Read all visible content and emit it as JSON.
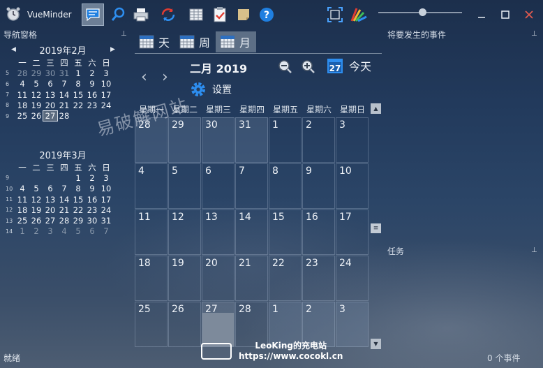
{
  "app": {
    "name": "VueMinder"
  },
  "nav_pane": {
    "title": "导航窗格"
  },
  "mini_calendars": [
    {
      "title": "2019年2月",
      "weekdays": [
        "一",
        "二",
        "三",
        "四",
        "五",
        "六",
        "日"
      ],
      "weeks": [
        {
          "num": "5",
          "days": [
            {
              "d": "28",
              "dim": true
            },
            {
              "d": "29",
              "dim": true
            },
            {
              "d": "30",
              "dim": true
            },
            {
              "d": "31",
              "dim": true
            },
            {
              "d": "1"
            },
            {
              "d": "2"
            },
            {
              "d": "3"
            }
          ]
        },
        {
          "num": "6",
          "days": [
            {
              "d": "4"
            },
            {
              "d": "5"
            },
            {
              "d": "6"
            },
            {
              "d": "7"
            },
            {
              "d": "8"
            },
            {
              "d": "9"
            },
            {
              "d": "10"
            }
          ]
        },
        {
          "num": "7",
          "days": [
            {
              "d": "11"
            },
            {
              "d": "12"
            },
            {
              "d": "13"
            },
            {
              "d": "14"
            },
            {
              "d": "15"
            },
            {
              "d": "16"
            },
            {
              "d": "17"
            }
          ]
        },
        {
          "num": "8",
          "days": [
            {
              "d": "18"
            },
            {
              "d": "19"
            },
            {
              "d": "20"
            },
            {
              "d": "21"
            },
            {
              "d": "22"
            },
            {
              "d": "23"
            },
            {
              "d": "24"
            }
          ]
        },
        {
          "num": "9",
          "days": [
            {
              "d": "25"
            },
            {
              "d": "26"
            },
            {
              "d": "27",
              "sel": true
            },
            {
              "d": "28"
            }
          ]
        }
      ]
    },
    {
      "title": "2019年3月",
      "weekdays": [
        "一",
        "二",
        "三",
        "四",
        "五",
        "六",
        "日"
      ],
      "weeks": [
        {
          "num": "9",
          "days": [
            {
              "d": ""
            },
            {
              "d": ""
            },
            {
              "d": ""
            },
            {
              "d": ""
            },
            {
              "d": "1"
            },
            {
              "d": "2"
            },
            {
              "d": "3"
            }
          ]
        },
        {
          "num": "10",
          "days": [
            {
              "d": "4"
            },
            {
              "d": "5"
            },
            {
              "d": "6"
            },
            {
              "d": "7"
            },
            {
              "d": "8"
            },
            {
              "d": "9"
            },
            {
              "d": "10"
            }
          ]
        },
        {
          "num": "11",
          "days": [
            {
              "d": "11"
            },
            {
              "d": "12"
            },
            {
              "d": "13"
            },
            {
              "d": "14"
            },
            {
              "d": "15"
            },
            {
              "d": "16"
            },
            {
              "d": "17"
            }
          ]
        },
        {
          "num": "12",
          "days": [
            {
              "d": "18"
            },
            {
              "d": "19"
            },
            {
              "d": "20"
            },
            {
              "d": "21"
            },
            {
              "d": "22"
            },
            {
              "d": "23"
            },
            {
              "d": "24"
            }
          ]
        },
        {
          "num": "13",
          "days": [
            {
              "d": "25"
            },
            {
              "d": "26"
            },
            {
              "d": "27"
            },
            {
              "d": "28"
            },
            {
              "d": "29"
            },
            {
              "d": "30"
            },
            {
              "d": "31"
            }
          ]
        },
        {
          "num": "14",
          "days": [
            {
              "d": "1",
              "dim": true
            },
            {
              "d": "2",
              "dim": true
            },
            {
              "d": "3",
              "dim": true
            },
            {
              "d": "4",
              "dim": true
            },
            {
              "d": "5",
              "dim": true
            },
            {
              "d": "6",
              "dim": true
            },
            {
              "d": "7",
              "dim": true
            }
          ]
        }
      ]
    }
  ],
  "view_tabs": [
    {
      "label": "天",
      "active": false
    },
    {
      "label": "周",
      "active": false
    },
    {
      "label": "月",
      "active": true
    }
  ],
  "month_view": {
    "title": "二月 2019",
    "today_label": "今天",
    "today_icon_number": "27",
    "settings_label": "设置",
    "weekdays": [
      "星期一",
      "星期二",
      "星期三",
      "星期四",
      "星期五",
      "星期六",
      "星期日"
    ],
    "weeks": [
      [
        {
          "d": "28",
          "other": true
        },
        {
          "d": "29",
          "other": true
        },
        {
          "d": "30",
          "other": true
        },
        {
          "d": "31",
          "other": true
        },
        {
          "d": "1"
        },
        {
          "d": "2"
        },
        {
          "d": "3"
        }
      ],
      [
        {
          "d": "4"
        },
        {
          "d": "5"
        },
        {
          "d": "6"
        },
        {
          "d": "7"
        },
        {
          "d": "8"
        },
        {
          "d": "9"
        },
        {
          "d": "10"
        }
      ],
      [
        {
          "d": "11"
        },
        {
          "d": "12"
        },
        {
          "d": "13"
        },
        {
          "d": "14"
        },
        {
          "d": "15"
        },
        {
          "d": "16"
        },
        {
          "d": "17"
        }
      ],
      [
        {
          "d": "18"
        },
        {
          "d": "19"
        },
        {
          "d": "20"
        },
        {
          "d": "21"
        },
        {
          "d": "22"
        },
        {
          "d": "23"
        },
        {
          "d": "24"
        }
      ],
      [
        {
          "d": "25"
        },
        {
          "d": "26"
        },
        {
          "d": "27",
          "today": true
        },
        {
          "d": "28"
        },
        {
          "d": "1",
          "other": true
        },
        {
          "d": "2",
          "other": true
        },
        {
          "d": "3",
          "other": true
        }
      ]
    ]
  },
  "right_panes": {
    "upcoming_title": "将要发生的事件",
    "tasks_title": "任务",
    "event_count": "0 个事件"
  },
  "status": {
    "left": "就绪"
  },
  "overlay": {
    "watermark": "易破解网站",
    "badge_line1": "LeoKing的充电站",
    "badge_line2": "https://www.cocokl.cn"
  },
  "colors": {
    "accent": "#1f7fe0",
    "refresh": "#e03c31",
    "close": "#e05a4f"
  },
  "icons": {
    "toolbar": [
      "message-icon",
      "search-icon",
      "print-icon",
      "refresh-icon",
      "grid-icon",
      "clipboard-icon",
      "note-icon",
      "help-icon"
    ],
    "right": [
      "fullscreen-icon",
      "color-theme-icon"
    ]
  }
}
